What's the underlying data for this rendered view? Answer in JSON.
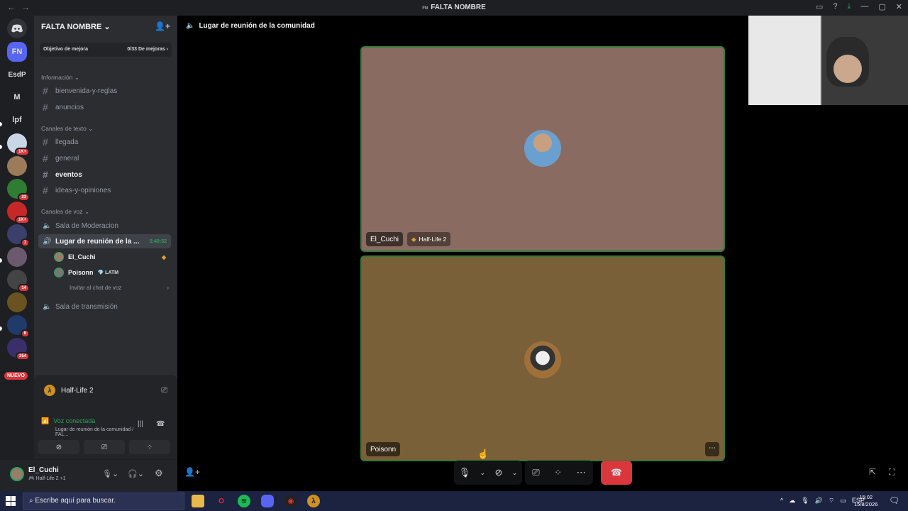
{
  "window": {
    "title": "FALTA NOMBRE",
    "title_tag": "FN"
  },
  "guilds": [
    {
      "label": "FN",
      "color": "#5865f2"
    },
    {
      "label": "EsdP",
      "color": "#1e1f22"
    },
    {
      "label": "M",
      "color": "#1e1f22"
    },
    {
      "label": "lpf",
      "color": "#1e1f22"
    }
  ],
  "guild_badges": [
    "1K+",
    "",
    "23",
    "1K+",
    "1",
    "",
    "14",
    "",
    "6",
    "254"
  ],
  "new_label": "NUEVO",
  "server": {
    "name": "FALTA NOMBRE",
    "goal_label": "Objetivo de mejora",
    "goal_value": "0/33 De mejoras"
  },
  "categories": {
    "info": "Información",
    "text": "Canales de texto",
    "voice": "Canales de voz"
  },
  "channels": {
    "bienvenida": "bienvenida-y-reglas",
    "anuncios": "anuncios",
    "llegada": "llegada",
    "general": "general",
    "eventos": "eventos",
    "ideas": "ideas-y-opiniones",
    "moderacion": "Sala de Moderacion",
    "reunion": "Lugar de reunión de la ...",
    "reunion_time": "5:49:52",
    "invite_voice": "Invitar al chat de voz",
    "transmision": "Sala de transmisión"
  },
  "voice_users": [
    {
      "name": "El_Cuchi"
    },
    {
      "name": "Poisonn",
      "tag": "LATM"
    }
  ],
  "activity": {
    "game": "Half-Life 2"
  },
  "voice_status": {
    "title": "Voz conectada",
    "subtitle": "Lugar de reunión de la comunidad / FAL..."
  },
  "user": {
    "name": "El_Cuchi",
    "status": "Half-Life 2 +1"
  },
  "stage": {
    "channel_title": "Lugar de reunión de la comunidad"
  },
  "tiles": [
    {
      "name": "El_Cuchi",
      "game": "Half-Life 2",
      "bg": "#8a6b61"
    },
    {
      "name": "Poisonn",
      "bg": "#7a6038"
    }
  ],
  "taskbar": {
    "search_placeholder": "Escribe aquí para buscar.",
    "lang": "ESP",
    "time": "15:02",
    "date": "15/8/2026"
  }
}
